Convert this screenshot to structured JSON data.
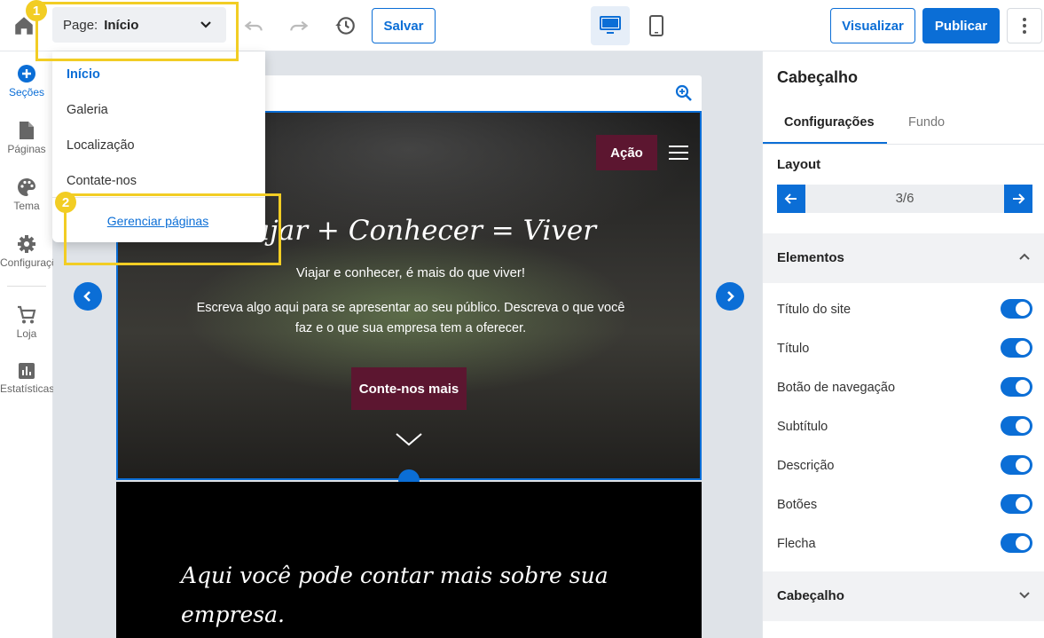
{
  "topbar": {
    "page_prefix": "Page:",
    "page_value": "Início",
    "save_label": "Salvar",
    "preview_label": "Visualizar",
    "publish_label": "Publicar"
  },
  "sidebar": {
    "items": [
      {
        "label": "Seções",
        "icon": "plus-circle-icon"
      },
      {
        "label": "Páginas",
        "icon": "page-icon"
      },
      {
        "label": "Tema",
        "icon": "palette-icon"
      },
      {
        "label": "Configurações",
        "icon": "gear-icon"
      },
      {
        "label": "Loja",
        "icon": "cart-icon"
      },
      {
        "label": "Estatísticas",
        "icon": "chart-icon"
      }
    ]
  },
  "dropdown": {
    "pages": [
      "Início",
      "Galeria",
      "Localização",
      "Contate-nos"
    ],
    "manage_label": "Gerenciar páginas"
  },
  "badges": {
    "one": "1",
    "two": "2"
  },
  "hero": {
    "action_label": "Ação",
    "title": "Viajar + Conhecer = Viver",
    "subtitle": "Viajar e conhecer, é mais do que viver!",
    "description": "Escreva algo aqui para se apresentar ao seu público. Descreva o que você faz e o que sua empresa tem a oferecer.",
    "button_label": "Conte-nos mais"
  },
  "about": {
    "text": "Aqui você pode contar mais sobre sua empresa."
  },
  "panel": {
    "title": "Cabeçalho",
    "tabs": [
      "Configurações",
      "Fundo"
    ],
    "layout_label": "Layout",
    "layout_count": "3/6",
    "elements_label": "Elementos",
    "toggles": [
      {
        "label": "Título do site",
        "on": true
      },
      {
        "label": "Título",
        "on": true
      },
      {
        "label": "Botão de navegação",
        "on": true
      },
      {
        "label": "Subtítulo",
        "on": true
      },
      {
        "label": "Descrição",
        "on": true
      },
      {
        "label": "Botões",
        "on": true
      },
      {
        "label": "Flecha",
        "on": true
      }
    ],
    "header_section_label": "Cabeçalho"
  },
  "colors": {
    "accent": "#0b6ed6",
    "highlight": "#f2cd24",
    "hero_button": "#5c1630"
  }
}
